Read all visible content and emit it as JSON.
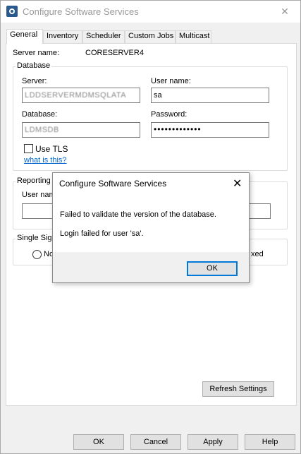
{
  "window": {
    "title": "Configure Software Services",
    "close_glyph": "✕"
  },
  "tabs": [
    {
      "label": "General"
    },
    {
      "label": "Inventory"
    },
    {
      "label": "Scheduler"
    },
    {
      "label": "Custom Jobs"
    },
    {
      "label": "Multicast"
    }
  ],
  "general": {
    "server_name_label": "Server name:",
    "server_name_value": "CORESERVER4",
    "database": {
      "legend": "Database",
      "server_label": "Server:",
      "server_value": "LDDSERVERMDMSQLATA",
      "user_label": "User name:",
      "user_value": "sa",
      "database_label": "Database:",
      "database_value": "LDMSDB",
      "password_label": "Password:",
      "password_value": "•••••••••••••",
      "use_tls_label": "Use TLS",
      "what_is_this_link": "what is this?"
    },
    "reporting": {
      "legend": "Reporting",
      "user_label": "User nam"
    },
    "sso": {
      "legend": "Single Sig",
      "radio_left_label": "No",
      "radio_right_label": "xed"
    },
    "refresh_button": "Refresh Settings"
  },
  "footer": {
    "ok": "OK",
    "cancel": "Cancel",
    "apply": "Apply",
    "help": "Help"
  },
  "dialog": {
    "title": "Configure Software Services",
    "close_glyph": "✕",
    "message_1": "Failed to validate the version of the database.",
    "message_2": "Login failed for user 'sa'.",
    "ok": "OK"
  },
  "colors": {
    "accent_blue": "#0078d7",
    "link_blue": "#0066cc"
  }
}
